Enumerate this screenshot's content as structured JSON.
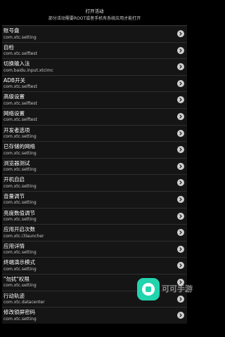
{
  "header": {
    "title": "打开活动",
    "subtitle": "部分活动需要ROOT或者手机有系统应用才能打开"
  },
  "items": [
    {
      "name": "账号盘",
      "pkg": "com.xtc.setting"
    },
    {
      "name": "自检",
      "pkg": "com.xtc.selftest"
    },
    {
      "name": "切换输入法",
      "pkg": "com.baidu.input.xtcimc"
    },
    {
      "name": "ADB开关",
      "pkg": "com.xtc.selftest"
    },
    {
      "name": "高级设置",
      "pkg": "com.xtc.selftest"
    },
    {
      "name": "网络设置",
      "pkg": "com.xtc.selftest"
    },
    {
      "name": "开发者选项",
      "pkg": "com.xtc.setting"
    },
    {
      "name": "已存储的网络",
      "pkg": "com.xtc.setting"
    },
    {
      "name": "浏览器测试",
      "pkg": "com.xtc.setting"
    },
    {
      "name": "开机自启",
      "pkg": "com.xtc.setting"
    },
    {
      "name": "音量调节",
      "pkg": "com.xtc.setting"
    },
    {
      "name": "亮度数值调节",
      "pkg": "com.xtc.setting"
    },
    {
      "name": "应用开启次数",
      "pkg": "com.xtc.i3launcher"
    },
    {
      "name": "应用详情",
      "pkg": "com.xtc.setting"
    },
    {
      "name": "终端演示模式",
      "pkg": "com.xtc.setting"
    },
    {
      "name": "\"勿扰\"权限",
      "pkg": "com.xtc.setting"
    },
    {
      "name": "行动轨迹",
      "pkg": "com.xtc.datacenter"
    },
    {
      "name": "修改锁屏密码",
      "pkg": "com.xtc.setting"
    }
  ],
  "watermark": {
    "label": "可可手游"
  },
  "colors": {
    "background": "#000000",
    "row": "#151515",
    "chevron": "#cfcfcf",
    "brand": "#22d4ad"
  },
  "icons": {
    "row_action": "chevron-right-icon",
    "watermark": "app-logo-icon"
  }
}
